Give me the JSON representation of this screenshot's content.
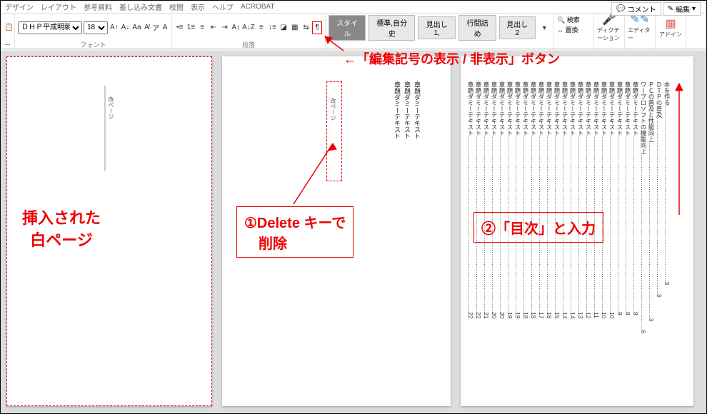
{
  "titlebar": {
    "comment": "コメント",
    "edit": "編集"
  },
  "tabs": {
    "t1": "デザイン",
    "t2": "レイアウト",
    "t3": "参考資料",
    "t4": "差し込み文書",
    "t5": "校閲",
    "t6": "表示",
    "t7": "ヘルプ",
    "t8": "ACROBAT"
  },
  "ribbon": {
    "font_name": "ＤＨＰ平成明朝体V",
    "font_size": "18",
    "group_font": "フォント",
    "group_para": "段落",
    "style_current": "スタイル",
    "style1": "標準,自分史",
    "style2": "見出し 1,",
    "style3": "行間詰め",
    "style4": "見出し 2",
    "find": "検索",
    "replace": "置換",
    "dictate": "ディクテーション",
    "editor": "エディター",
    "addin": "アドイン"
  },
  "annotations": {
    "toggle_marks": "←「編集記号の表示 / 非表示」ボタン",
    "inserted_blank_l1": "挿入された",
    "inserted_blank_l2": "白ページ",
    "delete_l1": "①Delete キーで",
    "delete_l2": "　削除",
    "type_toc": "②「目次」と入力"
  },
  "page2": {
    "float_label": "改ページ",
    "col1": "章題ダミーテキスト",
    "col2": "章題ダミーテキスト",
    "col3": "章題ダミーテキスト"
  },
  "page1": {
    "float_label": "改ページ"
  },
  "page3": {
    "lines": [
      {
        "t": "本を作る",
        "p": "3"
      },
      {
        "t": "ＤＴＰの普及",
        "p": "3"
      },
      {
        "t": "ＰＣの普及と性能向上",
        "p": "3"
      },
      {
        "t": "ワープロソフトの機能向上",
        "p": "6"
      },
      {
        "t": "章題ダミーテキスト",
        "p": "8"
      },
      {
        "t": "章題ダミーテキスト",
        "p": "8"
      },
      {
        "t": "章題ダミーテキスト",
        "p": "9"
      },
      {
        "t": "章題ダミーテキスト",
        "p": "10"
      },
      {
        "t": "章題ダミーテキスト",
        "p": "10"
      },
      {
        "t": "章題ダミーテキスト",
        "p": "11"
      },
      {
        "t": "章題ダミーテキスト",
        "p": "12"
      },
      {
        "t": "章題ダミーテキスト",
        "p": "13"
      },
      {
        "t": "章題ダミーテキスト",
        "p": "14"
      },
      {
        "t": "章題ダミーテキスト",
        "p": "14"
      },
      {
        "t": "章題ダミーテキスト",
        "p": "15"
      },
      {
        "t": "章題ダミーテキスト",
        "p": "16"
      },
      {
        "t": "章題ダミーテキスト",
        "p": "17"
      },
      {
        "t": "章題ダミーテキスト",
        "p": "18"
      },
      {
        "t": "章題ダミーテキスト",
        "p": "18"
      },
      {
        "t": "章題ダミーテキスト",
        "p": "19"
      },
      {
        "t": "章題ダミーテキスト",
        "p": "19"
      },
      {
        "t": "章題ダミーテキスト",
        "p": "20"
      },
      {
        "t": "章題ダミーテキスト",
        "p": "20"
      },
      {
        "t": "章題ダミーテキスト",
        "p": "21"
      },
      {
        "t": "章題ダミーテキスト",
        "p": "22"
      },
      {
        "t": "章題ダミーテキスト",
        "p": "22"
      }
    ]
  }
}
